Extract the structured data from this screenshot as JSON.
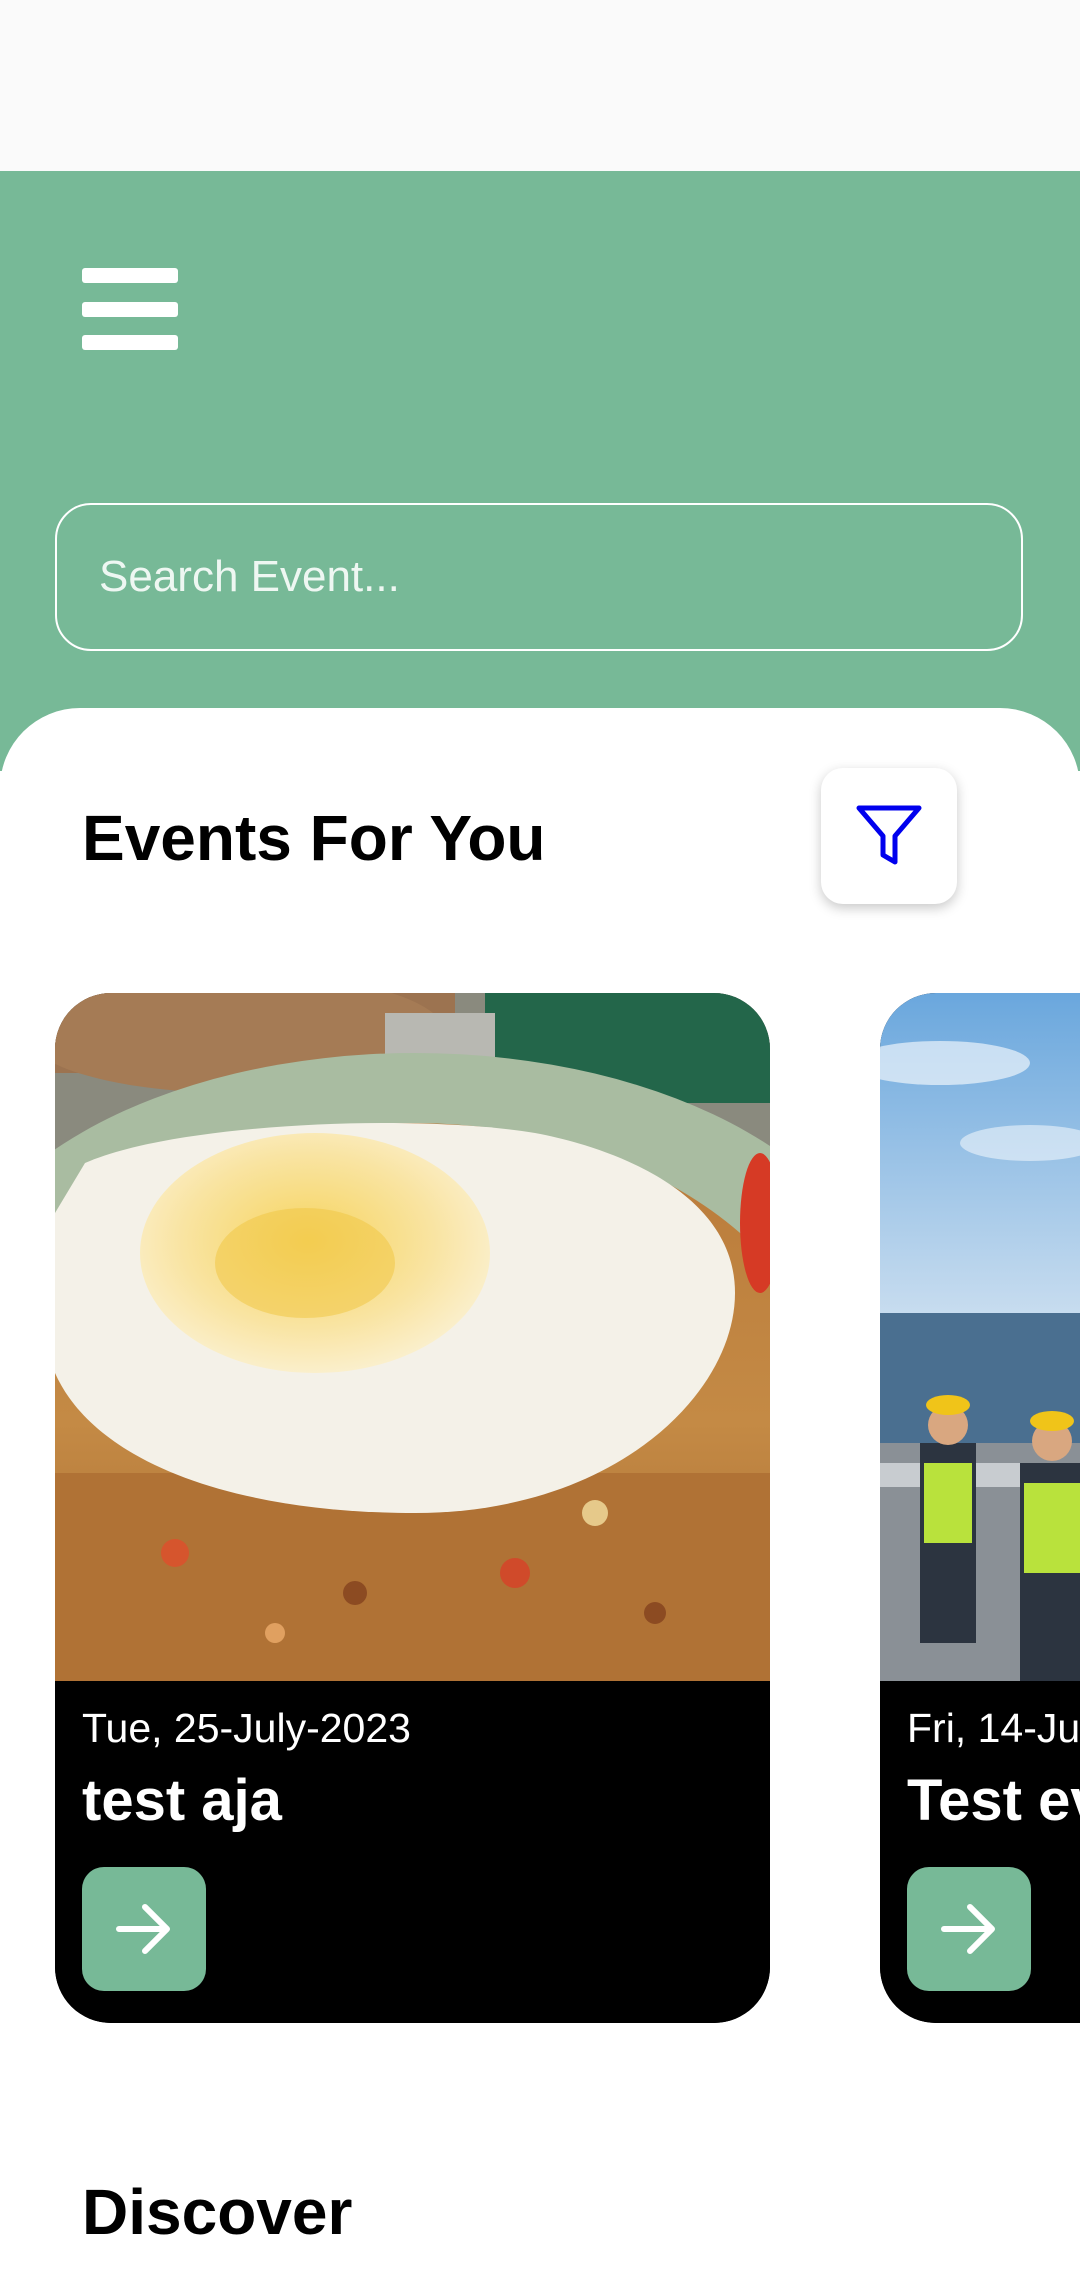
{
  "search": {
    "placeholder": "Search Event..."
  },
  "events_section": {
    "title": "Events For You"
  },
  "events": [
    {
      "date": "Tue, 25-July-2023",
      "title": "test aja"
    },
    {
      "date": "Fri, 14-Ju",
      "title": "Test ev"
    }
  ],
  "discover": {
    "title": "Discover"
  },
  "icons": {
    "menu": "hamburger-menu-icon",
    "filter": "filter-funnel-icon",
    "arrow": "arrow-right-icon"
  },
  "colors": {
    "accent": "#77b997",
    "status_bar": "#fafafa",
    "filter_icon": "#0000ee",
    "card_background": "#000000"
  }
}
